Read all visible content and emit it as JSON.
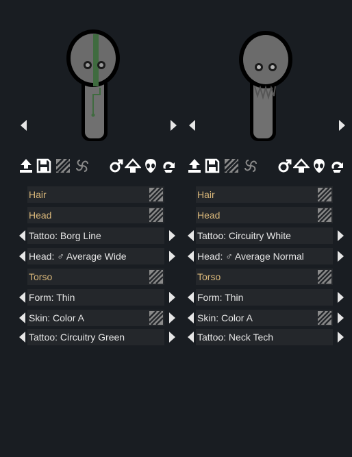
{
  "left": {
    "rows": [
      {
        "kind": "section",
        "label": "Hair",
        "hatch": true,
        "arrows": false
      },
      {
        "kind": "section",
        "label": "Head",
        "hatch": true,
        "arrows": false
      },
      {
        "kind": "value",
        "label": "Tattoo: Borg Line",
        "hatch": false,
        "arrows": true
      },
      {
        "kind": "value",
        "label": "Head: ♂ Average Wide",
        "hatch": false,
        "arrows": true
      },
      {
        "kind": "section",
        "label": "Torso",
        "hatch": true,
        "arrows": false
      },
      {
        "kind": "value",
        "label": "Form: Thin",
        "hatch": false,
        "arrows": true
      },
      {
        "kind": "value",
        "label": "Skin: Color A",
        "hatch": true,
        "arrows": true
      },
      {
        "kind": "value",
        "label": "Tattoo: Circuitry Green",
        "hatch": false,
        "arrows": true
      }
    ]
  },
  "right": {
    "rows": [
      {
        "kind": "section",
        "label": "Hair",
        "hatch": true,
        "arrows": false
      },
      {
        "kind": "section",
        "label": "Head",
        "hatch": true,
        "arrows": false
      },
      {
        "kind": "value",
        "label": "Tattoo: Circuitry White",
        "hatch": false,
        "arrows": true
      },
      {
        "kind": "value",
        "label": "Head: ♂ Average Normal",
        "hatch": false,
        "arrows": true
      },
      {
        "kind": "section",
        "label": "Torso",
        "hatch": true,
        "arrows": false
      },
      {
        "kind": "value",
        "label": "Form: Thin",
        "hatch": false,
        "arrows": true
      },
      {
        "kind": "value",
        "label": "Skin: Color A",
        "hatch": true,
        "arrows": true
      },
      {
        "kind": "value",
        "label": "Tattoo: Neck Tech",
        "hatch": false,
        "arrows": true
      }
    ]
  },
  "colors": {
    "background": "#191d22",
    "field": "#24272b",
    "section_text": "#d9b77a",
    "value_text": "#e6e6e6",
    "tattoo_green": "#3f6b3f"
  },
  "toolbar_icons": [
    "export-icon",
    "save-icon",
    "randomize-pattern-icon",
    "spiral-icon",
    "male-gender-icon",
    "clothes-hanger-icon",
    "alien-head-icon",
    "undo-icon"
  ]
}
